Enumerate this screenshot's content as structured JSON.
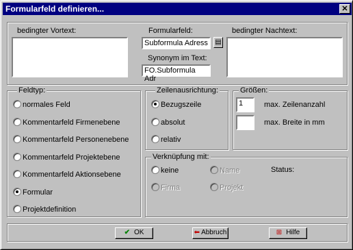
{
  "window": {
    "title": "Formularfeld definieren..."
  },
  "top": {
    "vortext_label": "bedingter Vortext:",
    "formularfeld_label": "Formularfeld:",
    "formularfeld_value": "Subformula Adress",
    "synonym_label": "Synonym im Text:",
    "synonym_value": "FO.Subformula Adr",
    "nachtext_label": "bedingter Nachtext:"
  },
  "feldtyp": {
    "label": "Feldtyp:",
    "options": [
      "normales Feld",
      "Kommentarfeld Firmenebene",
      "Kommentarfeld Personenebene",
      "Kommentarfeld Projektebene",
      "Kommentarfeld Aktionsebene",
      "Formular",
      "Projektdefinition"
    ],
    "selected": "Formular"
  },
  "zeilen": {
    "label": "Zeilenausrichtung:",
    "options": [
      "Bezugszeile",
      "absolut",
      "relativ"
    ],
    "selected": "Bezugszeile"
  },
  "groessen": {
    "label": "Größen:",
    "zeilen_value": "1",
    "zeilen_label": "max. Zeilenanzahl",
    "breite_value": "",
    "breite_label": "max. Breite in mm"
  },
  "verknuepfung": {
    "label": "Verknüpfung mit:",
    "options": [
      "keine",
      "Name",
      "Firma",
      "Projekt"
    ],
    "status_label": "Status:"
  },
  "buttons": {
    "ok": "OK",
    "abbruch": "Abbruch",
    "hilfe": "Hilfe"
  }
}
